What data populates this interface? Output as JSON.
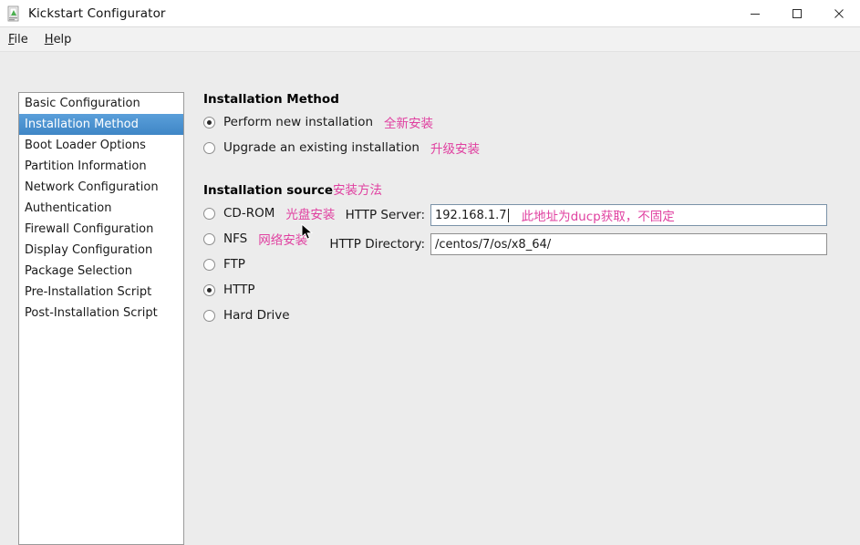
{
  "window": {
    "title": "Kickstart Configurator",
    "app_icon": "kickstart-icon",
    "minimize_label": "Minimize",
    "maximize_label": "Maximize",
    "close_label": "Close"
  },
  "menubar": {
    "items": [
      {
        "label": "File",
        "mnemonic": "F",
        "rest": "ile"
      },
      {
        "label": "Help",
        "mnemonic": "H",
        "rest": "elp"
      }
    ]
  },
  "sidebar": {
    "selected_index": 1,
    "items": [
      {
        "label": "Basic Configuration"
      },
      {
        "label": "Installation Method"
      },
      {
        "label": "Boot Loader Options"
      },
      {
        "label": "Partition Information"
      },
      {
        "label": "Network Configuration"
      },
      {
        "label": "Authentication"
      },
      {
        "label": "Firewall Configuration"
      },
      {
        "label": "Display Configuration"
      },
      {
        "label": "Package Selection"
      },
      {
        "label": "Pre-Installation Script"
      },
      {
        "label": "Post-Installation Script"
      }
    ]
  },
  "main": {
    "method": {
      "title": "Installation Method",
      "options": [
        {
          "label": "Perform new installation",
          "annotation": "全新安装",
          "selected": true
        },
        {
          "label": "Upgrade an existing installation",
          "annotation": "升级安装",
          "selected": false
        }
      ]
    },
    "source": {
      "title": "Installation source",
      "title_annotation": "安装方法",
      "options": [
        {
          "label": "CD-ROM",
          "annotation": "光盘安装",
          "selected": false
        },
        {
          "label": "NFS",
          "annotation": "网络安装",
          "selected": false
        },
        {
          "label": "FTP",
          "annotation": "",
          "selected": false
        },
        {
          "label": "HTTP",
          "annotation": "",
          "selected": true
        },
        {
          "label": "Hard Drive",
          "annotation": "",
          "selected": false
        }
      ],
      "fields": [
        {
          "label": "HTTP Server:",
          "value": "192.168.1.7",
          "annotation": "此地址为ducp获取，不固定",
          "focused": true
        },
        {
          "label": "HTTP Directory:",
          "value": "/centos/7/os/x8_64/",
          "annotation": "",
          "focused": false
        }
      ]
    }
  },
  "colors": {
    "accent_selection": "#3f86c6",
    "annotation_pink": "#e040a0",
    "window_bg": "#ececec",
    "titlebar_bg": "#ffffff"
  }
}
